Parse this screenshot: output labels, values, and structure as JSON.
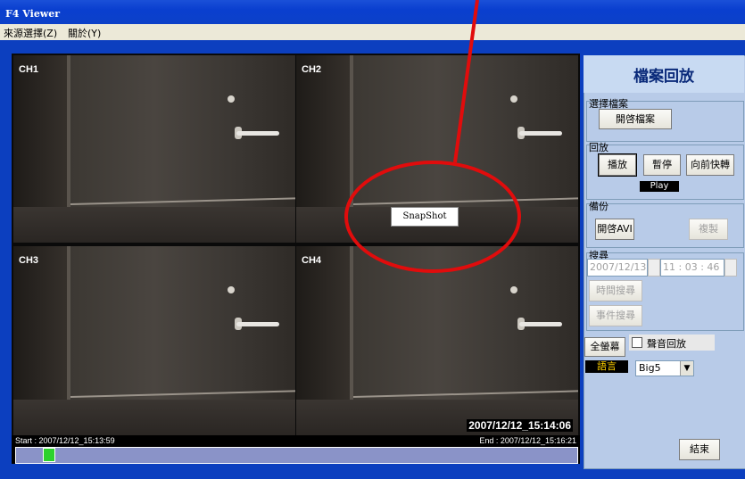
{
  "window": {
    "title": "F4 Viewer"
  },
  "menu": {
    "items": [
      "來源選擇(Z)",
      "關於(Y)"
    ]
  },
  "video": {
    "channels": [
      "CH1",
      "CH2",
      "CH3",
      "CH4"
    ],
    "timestamp": "2007/12/12_15:14:06",
    "context_popup": "SnapShot"
  },
  "timeline": {
    "start": "Start : 2007/12/12_15:13:59",
    "end": "End : 2007/12/12_15:16:21",
    "progress": 0.05
  },
  "panel": {
    "title": "檔案回放",
    "select_file": {
      "label": "選擇檔案",
      "open_button": "開啓檔案"
    },
    "playback": {
      "label": "回放",
      "play": "播放",
      "pause": "暫停",
      "forward": "向前快轉",
      "status": "Play"
    },
    "backup": {
      "label": "備份",
      "open_avi": "開啓AVI",
      "copy": "複製"
    },
    "search": {
      "label": "搜尋",
      "date": "2007/12/13",
      "time": "11 : 03 : 46",
      "time_search": "時間搜尋",
      "event_search": "事件搜尋"
    },
    "fullscreen": "全螢幕",
    "audio_playback": "聲音回放",
    "language_label": "語言",
    "language_value": "Big5",
    "exit": "結束"
  },
  "colors": {
    "frame": "#0c3fbf",
    "panel": "#b8cbe8",
    "annotation": "#e10c0c"
  }
}
